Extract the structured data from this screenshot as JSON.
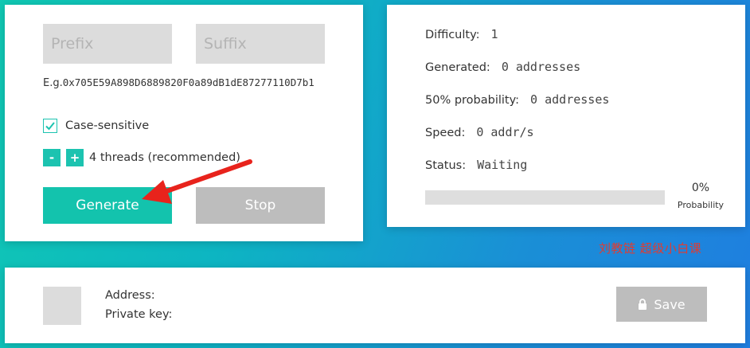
{
  "input": {
    "prefix_placeholder": "Prefix",
    "suffix_placeholder": "Suffix",
    "example_label": "E.g.",
    "example_address": "0x705E59A898D6889820F0a89dB1dE87277110D7b1",
    "case_sensitive_label": "Case-sensitive",
    "case_sensitive_checked": true,
    "minus_label": "-",
    "plus_label": "+",
    "threads_label": "4 threads (recommended)",
    "generate_label": "Generate",
    "stop_label": "Stop"
  },
  "stats": {
    "difficulty_label": "Difficulty:",
    "difficulty_value": "1",
    "generated_label": "Generated:",
    "generated_value": "0 addresses",
    "probability_label": "50% probability:",
    "probability_value": "0 addresses",
    "speed_label": "Speed:",
    "speed_value": "0 addr/s",
    "status_label": "Status:",
    "status_value": "Waiting",
    "progress_percent": "0%",
    "progress_value": 0,
    "progress_caption": "Probability"
  },
  "watermark": "刘教链 超级小白课",
  "result": {
    "address_label": "Address:",
    "private_key_label": "Private key:",
    "save_label": "Save",
    "save_icon": "lock-icon"
  },
  "colors": {
    "accent": "#13c3ad",
    "disabled": "#bdbdbd",
    "annotation": "#e8231c"
  }
}
